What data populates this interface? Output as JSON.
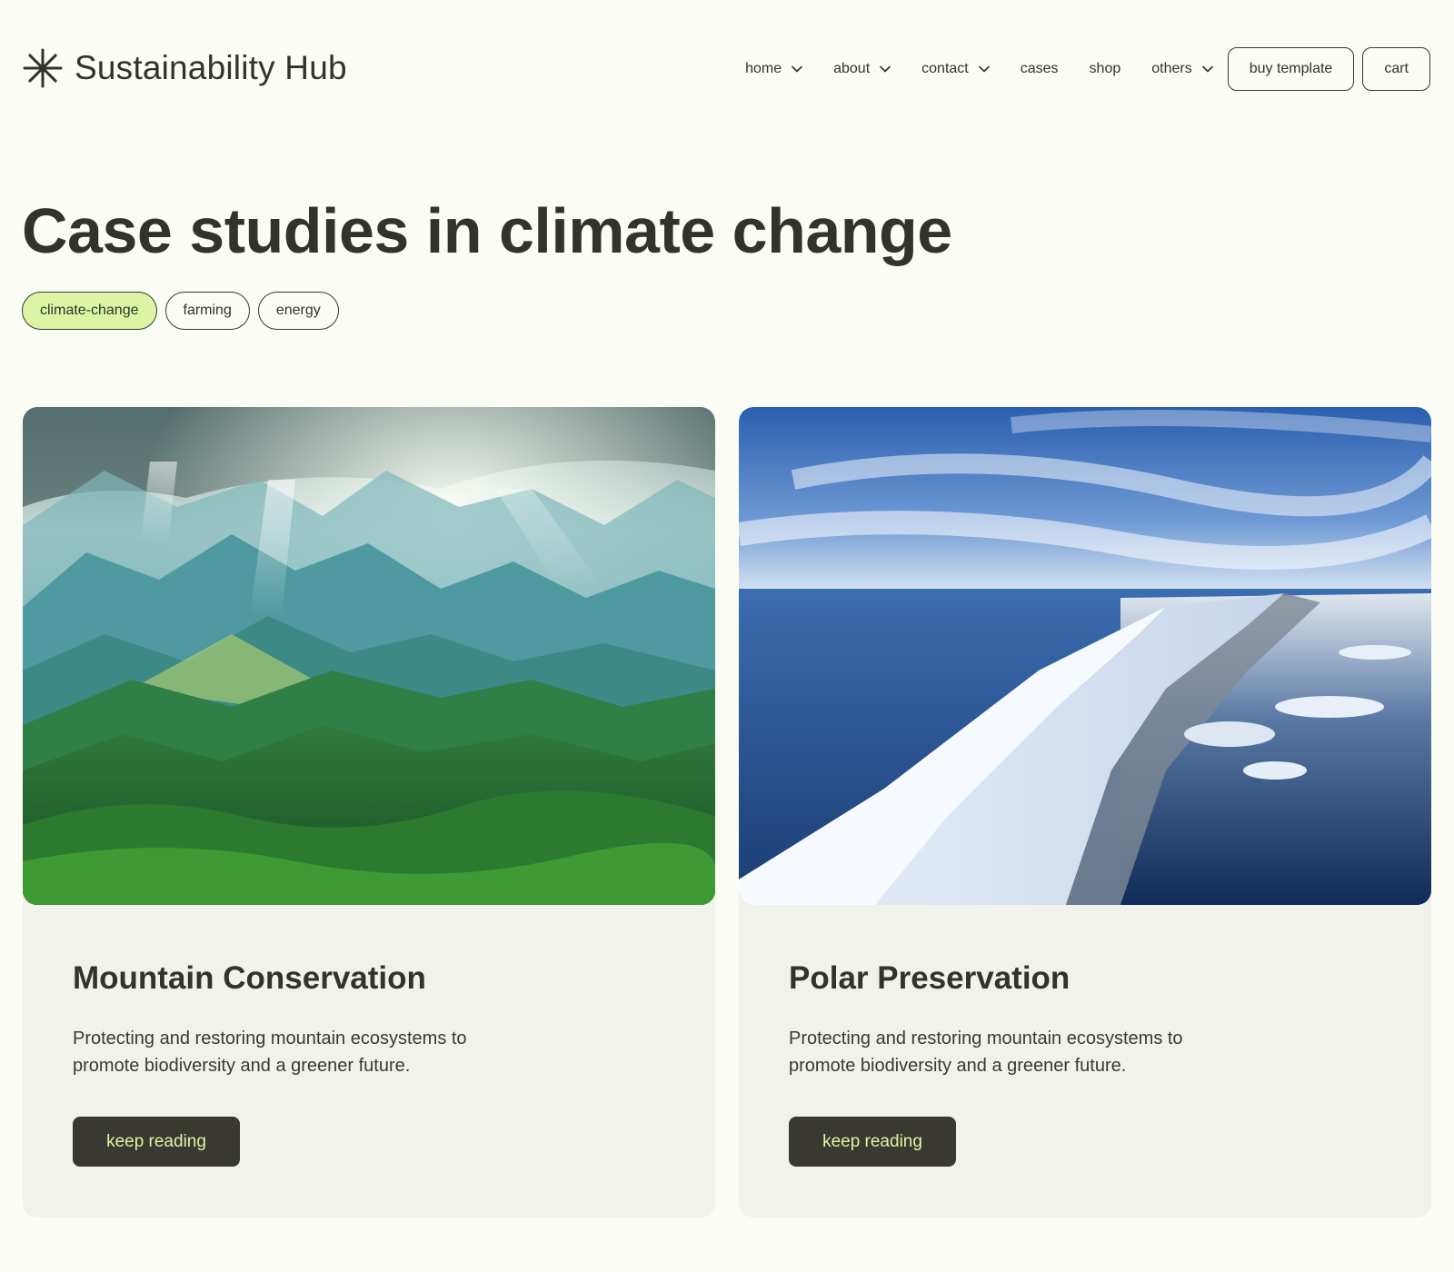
{
  "brand": {
    "name": "Sustainability Hub",
    "icon": "asterisk-sun-icon"
  },
  "nav": {
    "items": [
      {
        "label": "home",
        "has_dropdown": true
      },
      {
        "label": "about",
        "has_dropdown": true
      },
      {
        "label": "contact",
        "has_dropdown": true
      },
      {
        "label": "cases",
        "has_dropdown": false
      },
      {
        "label": "shop",
        "has_dropdown": false
      },
      {
        "label": "others",
        "has_dropdown": true
      }
    ],
    "buy_template": "buy template",
    "cart": "cart"
  },
  "page": {
    "title": "Case studies in climate change",
    "tags": [
      {
        "label": "climate-change",
        "active": true
      },
      {
        "label": "farming",
        "active": false
      },
      {
        "label": "energy",
        "active": false
      }
    ]
  },
  "cards": [
    {
      "title": "Mountain Conservation",
      "description": "Protecting and restoring mountain ecosystems to promote biodiversity and a greener future.",
      "button": "keep reading"
    },
    {
      "title": "Polar Preservation",
      "description": "Protecting and restoring mountain ecosystems to promote biodiversity and a greener future.",
      "button": "keep reading"
    }
  ],
  "colors": {
    "background": "#fbfcf4",
    "text": "#33322b",
    "accent": "#dcf5a4",
    "card_bg": "#f1f3ea",
    "button_bg": "#3a3931"
  }
}
